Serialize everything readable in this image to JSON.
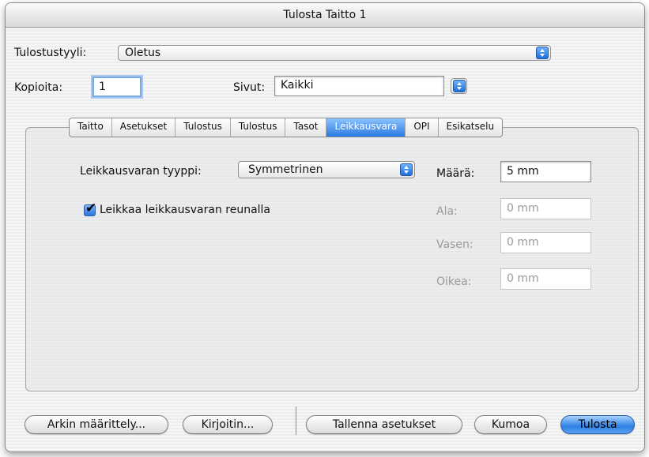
{
  "window": {
    "title": "Tulosta Taitto 1"
  },
  "top": {
    "style_label": "Tulostustyyli:",
    "style_value": "Oletus",
    "copies_label": "Kopioita:",
    "copies_value": "1",
    "pages_label": "Sivut:",
    "pages_value": "Kaikki"
  },
  "tabs": [
    {
      "label": "Taitto"
    },
    {
      "label": "Asetukset"
    },
    {
      "label": "Tulostus"
    },
    {
      "label": "Tulostus"
    },
    {
      "label": "Tasot"
    },
    {
      "label": "Leikkausvara",
      "active": true
    },
    {
      "label": "OPI"
    },
    {
      "label": "Esikatselu"
    }
  ],
  "bleed": {
    "type_label": "Leikkausvaran tyyppi:",
    "type_value": "Symmetrinen",
    "clip_checkbox_label": "Leikkaa leikkausvaran reunalla",
    "clip_checked": true,
    "amount_label": "Määrä:",
    "amount_value": "5 mm",
    "bottom_label": "Ala:",
    "bottom_value": "0 mm",
    "left_label": "Vasen:",
    "left_value": "0 mm",
    "right_label": "Oikea:",
    "right_value": "0 mm"
  },
  "buttons": {
    "page_setup": "Arkin määrittely...",
    "printer": "Kirjoitin...",
    "save_settings": "Tallenna asetukset",
    "cancel": "Kumoa",
    "print": "Tulosta"
  },
  "colors": {
    "accent": "#2a7ae2",
    "disabled_text": "#9b9b9b"
  }
}
